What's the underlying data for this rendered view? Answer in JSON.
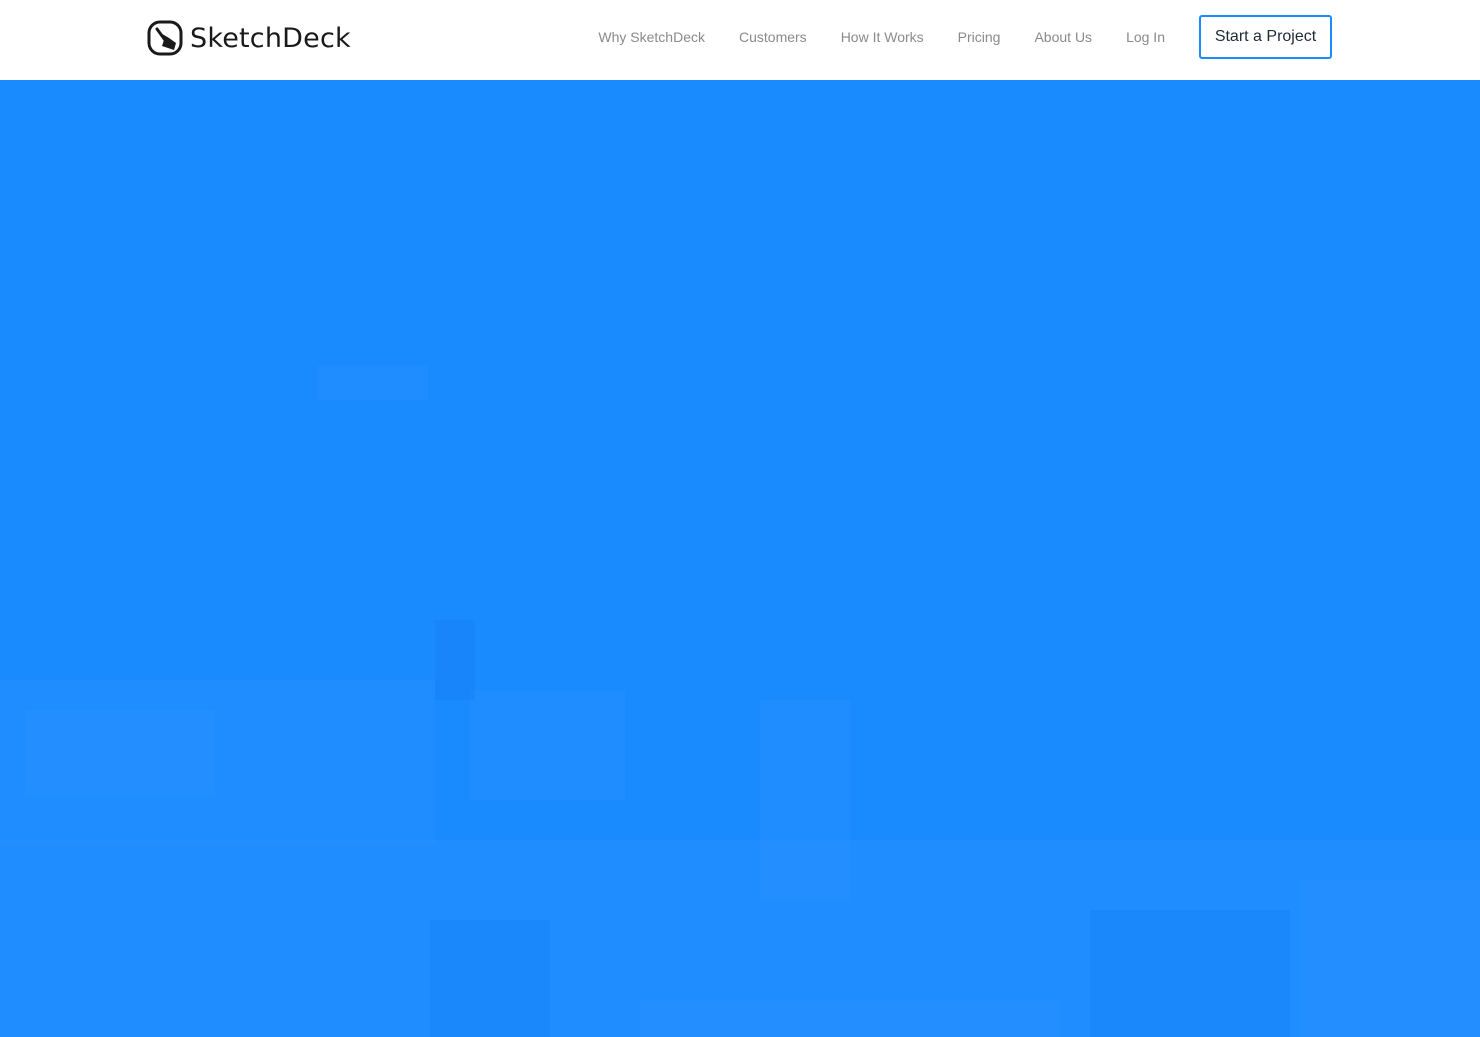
{
  "brand": {
    "name": "SketchDeck",
    "logo_icon": "sketchdeck-logo-icon"
  },
  "nav": {
    "items": [
      {
        "label": "Why SketchDeck"
      },
      {
        "label": "Customers"
      },
      {
        "label": "How It Works"
      },
      {
        "label": "Pricing"
      },
      {
        "label": "About Us"
      },
      {
        "label": "Log In"
      }
    ],
    "cta_label": "Start a Project"
  },
  "colors": {
    "accent": "#1a8bff",
    "hero_background": "#1a8aff",
    "nav_text": "#8a8a8a",
    "cta_text": "#1e2a38"
  }
}
